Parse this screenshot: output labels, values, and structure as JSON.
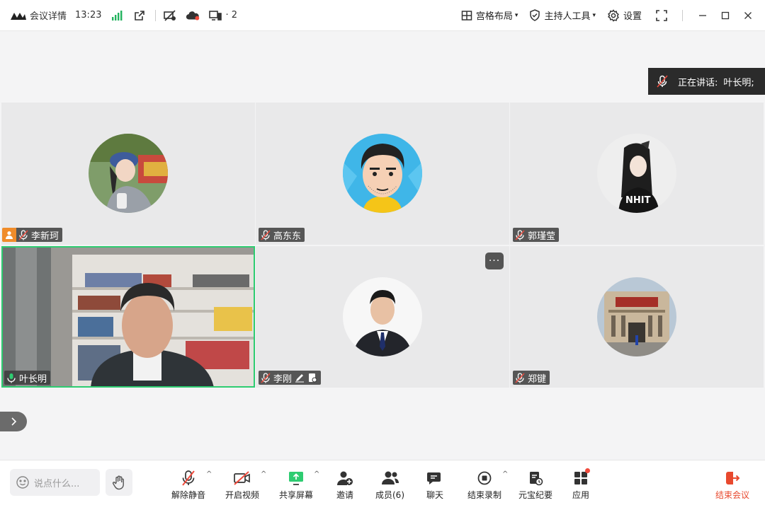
{
  "titlebar": {
    "meeting_details": "会议详情",
    "time": "13:23",
    "device_count": "· 2",
    "layout_btn": "宫格布局",
    "host_tools_btn": "主持人工具",
    "settings_btn": "设置"
  },
  "speaking": {
    "label": "正在讲话:",
    "name": "叶长明;"
  },
  "participants": [
    {
      "name": "李新珂",
      "host": true
    },
    {
      "name": "高东东"
    },
    {
      "name": "郭瑾莹"
    },
    {
      "name": "叶长明",
      "speaking": true
    },
    {
      "name": "李刚"
    },
    {
      "name": "郑键"
    }
  ],
  "more_label": "···",
  "toolbar": {
    "chat_placeholder": "说点什么...",
    "unmute": "解除静音",
    "start_video": "开启视频",
    "share_screen": "共享屏幕",
    "invite": "邀请",
    "members": "成员(6)",
    "chat": "聊天",
    "end_record": "结束录制",
    "yuanbao": "元宝纪要",
    "apps": "应用",
    "end_meeting": "结束会议"
  },
  "colors": {
    "accent_green": "#2ecc71",
    "end_red": "#e8492e",
    "host_orange": "#f08c2a"
  }
}
